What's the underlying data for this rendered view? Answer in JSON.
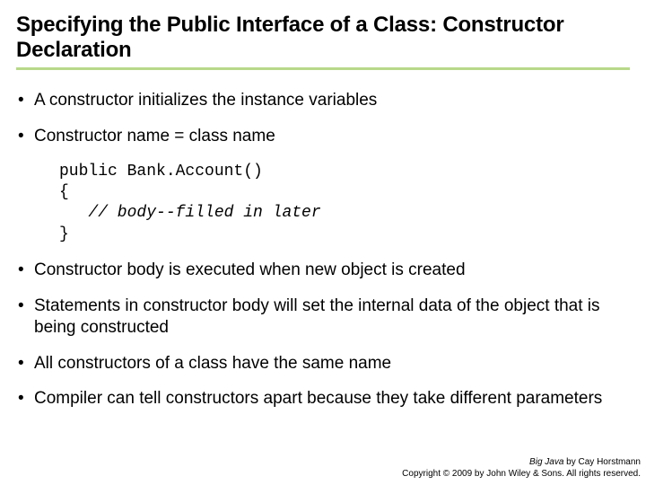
{
  "title": "Specifying the Public Interface of a Class: Constructor Declaration",
  "bullets": [
    "A constructor initializes the instance variables",
    "Constructor name = class name",
    "Constructor body is executed when new object is created",
    "Statements in constructor body will set the internal data of the object that is being constructed",
    "All constructors of a class have the same name",
    "Compiler can tell constructors apart because they take different parameters"
  ],
  "code": {
    "line1": "public Bank.Account()",
    "line2": "{",
    "line3_indent": "   ",
    "line3_comment": "// body--filled in later",
    "line4": "}"
  },
  "footer": {
    "book": "Big Java",
    "by": " by Cay Horstmann",
    "copyright": "Copyright © 2009 by John Wiley & Sons.  All rights reserved."
  }
}
